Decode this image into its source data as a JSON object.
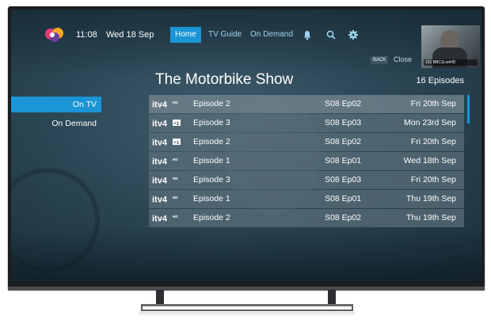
{
  "header": {
    "time": "11:08",
    "date": "Wed 18 Sep",
    "nav": [
      "Home",
      "TV Guide",
      "On Demand"
    ],
    "active_nav": "Home",
    "icons": [
      "bell-icon",
      "search-icon",
      "gear-icon"
    ],
    "preview_caption": "101 BBC1LonHD"
  },
  "back": {
    "badge": "BACK",
    "label": "Close"
  },
  "show": {
    "title": "The Motorbike Show",
    "count": "16 Episodes"
  },
  "sidebar": {
    "items": [
      "On TV",
      "On Demand"
    ],
    "active": "On TV"
  },
  "episodes": [
    {
      "channel": "itv4 HD",
      "title": "Episode 2",
      "code": "S08 Ep02",
      "date": "Fri 20th Sep"
    },
    {
      "channel": "itv4 +1",
      "title": "Episode 3",
      "code": "S08 Ep03",
      "date": "Mon 23rd Sep"
    },
    {
      "channel": "itv4 +1",
      "title": "Episode 2",
      "code": "S08 Ep02",
      "date": "Fri 20th Sep"
    },
    {
      "channel": "itv4 HD",
      "title": "Episode 1",
      "code": "S08 Ep01",
      "date": "Wed 18th Sep"
    },
    {
      "channel": "itv4 HD",
      "title": "Episode 3",
      "code": "S08 Ep03",
      "date": "Fri 20th Sep"
    },
    {
      "channel": "itv4 HD",
      "title": "Episode 1",
      "code": "S08 Ep01",
      "date": "Thu 19th Sep"
    },
    {
      "channel": "itv4 HD",
      "title": "Episode 2",
      "code": "S08 Ep02",
      "date": "Thu 19th Sep"
    }
  ],
  "colors": {
    "accent": "#1a95d5",
    "row": "#5a6e78",
    "screen_bg": "#33505f"
  }
}
